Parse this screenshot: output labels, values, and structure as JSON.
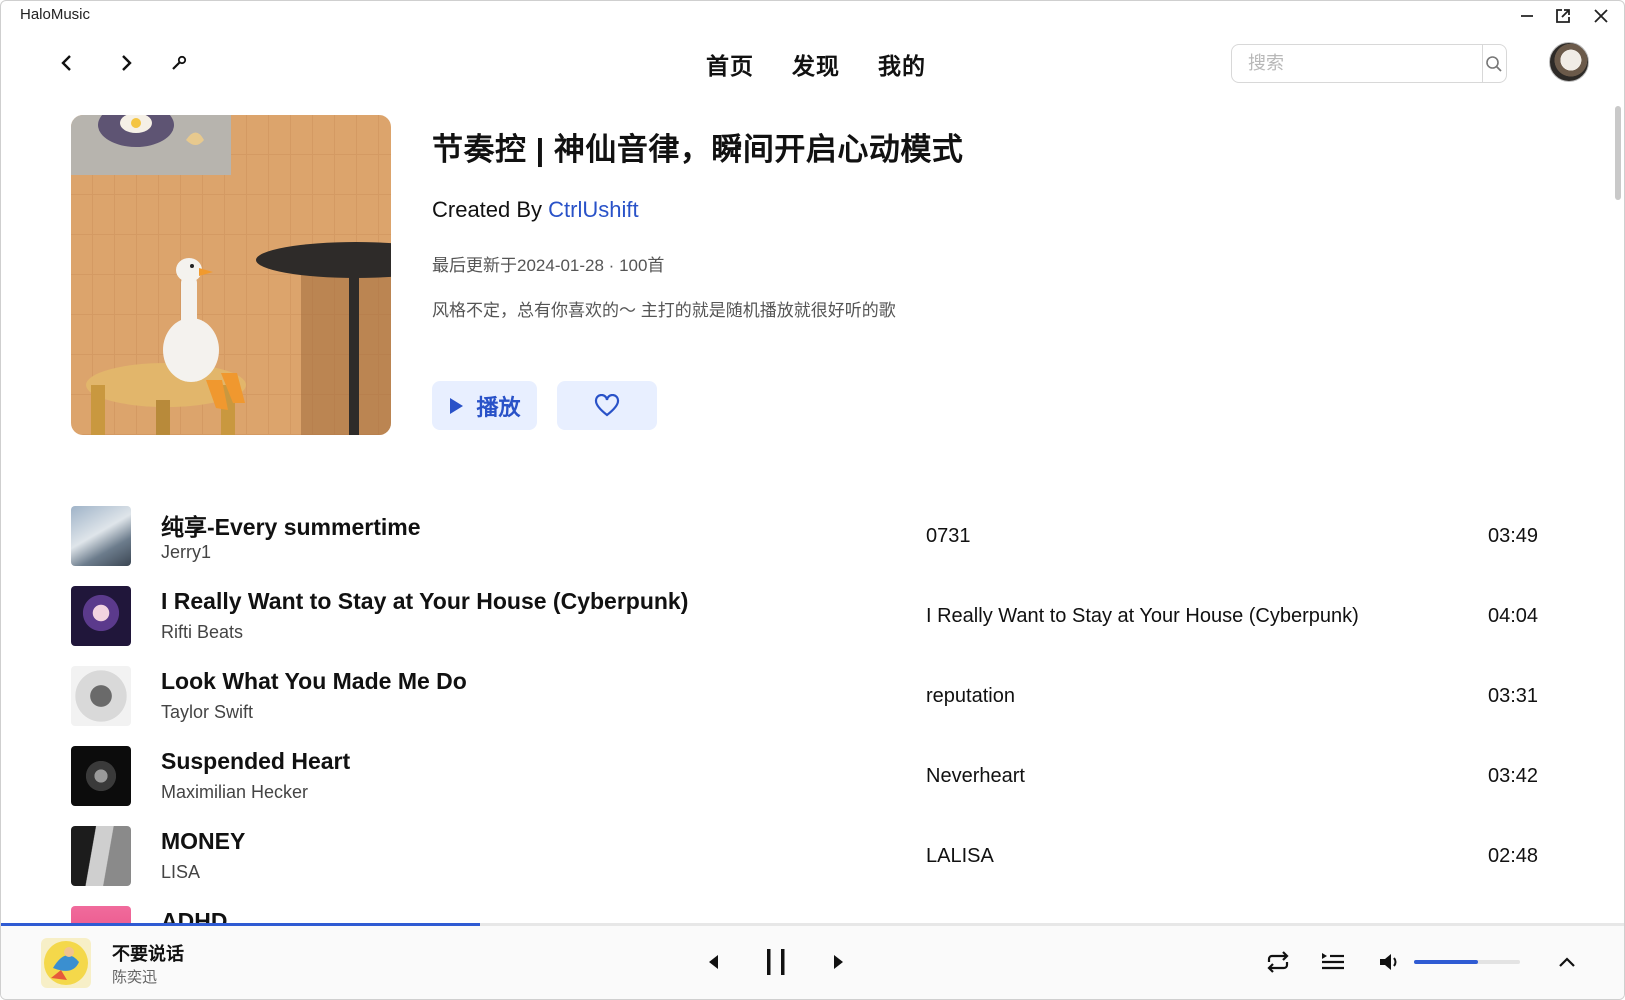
{
  "window": {
    "title": "HaloMusic"
  },
  "nav": {
    "tabs": [
      "首页",
      "发现",
      "我的"
    ],
    "search_placeholder": "搜索"
  },
  "playlist": {
    "title": "节奏控 | 神仙音律，瞬间开启心动模式",
    "created_by_prefix": "Created By ",
    "creator": "CtrlUshift",
    "meta": "最后更新于2024-01-28 · 100首",
    "description": "风格不定，总有你喜欢的～ 主打的就是随机播放就很好听的歌",
    "play_label": "播放"
  },
  "tracks": [
    {
      "title": "纯享-Every summertime",
      "artist": "Jerry1",
      "album": "0731",
      "duration": "03:49"
    },
    {
      "title": "I Really Want to Stay at Your House (Cyberpunk)",
      "artist": "Rifti Beats",
      "album": "I Really Want to Stay at Your House (Cyberpunk)",
      "duration": "04:04"
    },
    {
      "title": "Look What You Made Me Do",
      "artist": "Taylor Swift",
      "album": "reputation",
      "duration": "03:31"
    },
    {
      "title": "Suspended Heart",
      "artist": "Maximilian Hecker",
      "album": "Neverheart",
      "duration": "03:42"
    },
    {
      "title": "MONEY",
      "artist": "LISA",
      "album": "LALISA",
      "duration": "02:48"
    },
    {
      "title": "ADHD",
      "artist": "",
      "album": "",
      "duration": ""
    }
  ],
  "player": {
    "title": "不要说话",
    "artist": "陈奕迅",
    "progress": 0.295,
    "volume": 0.6
  },
  "colors": {
    "accent": "#2f5bd3",
    "accent_bg": "#e8efff"
  }
}
